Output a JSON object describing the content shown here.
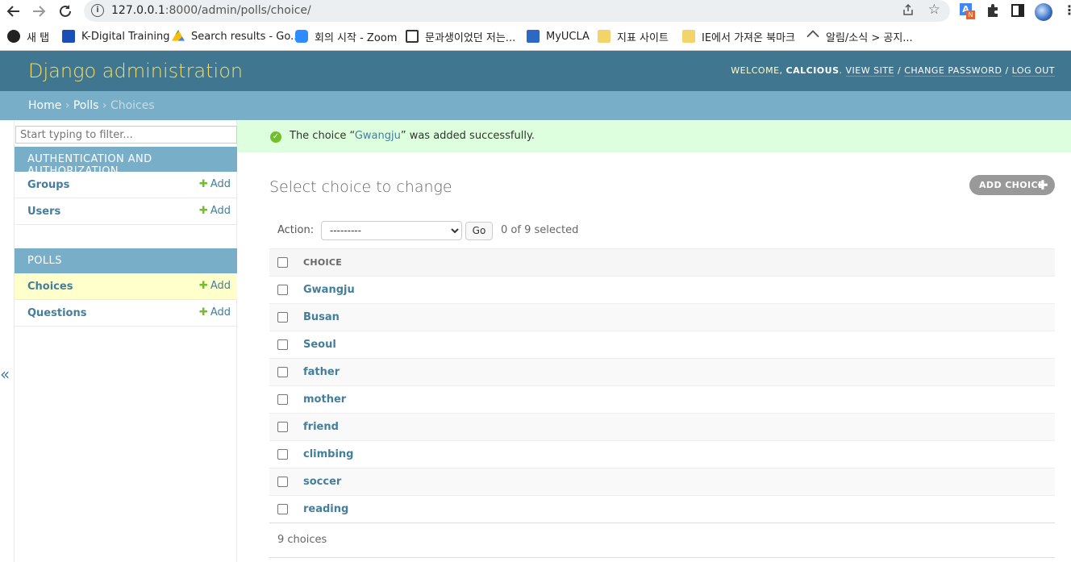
{
  "browser": {
    "url_host": "127.0.0.1",
    "url_rest": ":8000/admin/polls/choice/",
    "bookmarks": [
      {
        "label": "새 탭",
        "color": "#222"
      },
      {
        "label": "K-Digital Training",
        "color": "#1a4fb8"
      },
      {
        "label": "Search results - Go...",
        "color": "#34a853"
      },
      {
        "label": "회의 시작 - Zoom",
        "color": "#2d8cff"
      },
      {
        "label": "문과생이었던 저는...",
        "color": "#333"
      },
      {
        "label": "MyUCLA",
        "color": "#2d68c4"
      },
      {
        "label": "지표 사이트",
        "color": "#f5d36b"
      },
      {
        "label": "IE에서 가져온 북마크",
        "color": "#f5d36b"
      },
      {
        "label": "알림/소식 > 공지...",
        "color": "#555"
      }
    ]
  },
  "header": {
    "branding": "Django administration",
    "welcome": "WELCOME, ",
    "username": "CALCIOUS",
    "view_site": "VIEW SITE",
    "change_password": "CHANGE PASSWORD",
    "log_out": "LOG OUT"
  },
  "breadcrumbs": {
    "home": "Home",
    "app": "Polls",
    "current": "Choices"
  },
  "sidebar": {
    "filter_placeholder": "Start typing to filter...",
    "modules": [
      {
        "caption": "AUTHENTICATION AND AUTHORIZATION",
        "models": [
          {
            "name": "Groups",
            "add": "Add"
          },
          {
            "name": "Users",
            "add": "Add"
          }
        ]
      },
      {
        "caption": "POLLS",
        "models": [
          {
            "name": "Choices",
            "add": "Add"
          },
          {
            "name": "Questions",
            "add": "Add"
          }
        ]
      }
    ],
    "collapse": "«"
  },
  "message": {
    "prefix": "The choice “",
    "link": "Gwangju",
    "suffix": "” was added successfully."
  },
  "content": {
    "title": "Select choice to change",
    "add_button": "ADD CHOICE",
    "action_label": "Action:",
    "action_select": "---------",
    "go": "Go",
    "counter": "0 of 9 selected",
    "column": "CHOICE",
    "rows": [
      "Gwangju",
      "Busan",
      "Seoul",
      "father",
      "mother",
      "friend",
      "climbing",
      "soccer",
      "reading"
    ],
    "paginator": "9 choices"
  }
}
